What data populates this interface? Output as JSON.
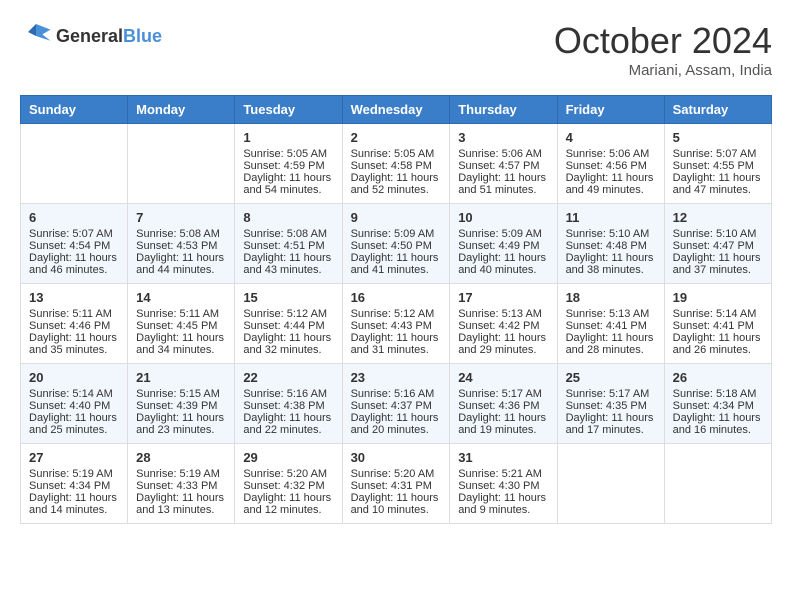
{
  "header": {
    "logo_general": "General",
    "logo_blue": "Blue",
    "month_title": "October 2024",
    "location": "Mariani, Assam, India"
  },
  "days_of_week": [
    "Sunday",
    "Monday",
    "Tuesday",
    "Wednesday",
    "Thursday",
    "Friday",
    "Saturday"
  ],
  "weeks": [
    [
      {
        "day": "",
        "sunrise": "",
        "sunset": "",
        "daylight": "",
        "empty": true
      },
      {
        "day": "",
        "sunrise": "",
        "sunset": "",
        "daylight": "",
        "empty": true
      },
      {
        "day": "1",
        "sunrise": "Sunrise: 5:05 AM",
        "sunset": "Sunset: 4:59 PM",
        "daylight": "Daylight: 11 hours and 54 minutes."
      },
      {
        "day": "2",
        "sunrise": "Sunrise: 5:05 AM",
        "sunset": "Sunset: 4:58 PM",
        "daylight": "Daylight: 11 hours and 52 minutes."
      },
      {
        "day": "3",
        "sunrise": "Sunrise: 5:06 AM",
        "sunset": "Sunset: 4:57 PM",
        "daylight": "Daylight: 11 hours and 51 minutes."
      },
      {
        "day": "4",
        "sunrise": "Sunrise: 5:06 AM",
        "sunset": "Sunset: 4:56 PM",
        "daylight": "Daylight: 11 hours and 49 minutes."
      },
      {
        "day": "5",
        "sunrise": "Sunrise: 5:07 AM",
        "sunset": "Sunset: 4:55 PM",
        "daylight": "Daylight: 11 hours and 47 minutes."
      }
    ],
    [
      {
        "day": "6",
        "sunrise": "Sunrise: 5:07 AM",
        "sunset": "Sunset: 4:54 PM",
        "daylight": "Daylight: 11 hours and 46 minutes."
      },
      {
        "day": "7",
        "sunrise": "Sunrise: 5:08 AM",
        "sunset": "Sunset: 4:53 PM",
        "daylight": "Daylight: 11 hours and 44 minutes."
      },
      {
        "day": "8",
        "sunrise": "Sunrise: 5:08 AM",
        "sunset": "Sunset: 4:51 PM",
        "daylight": "Daylight: 11 hours and 43 minutes."
      },
      {
        "day": "9",
        "sunrise": "Sunrise: 5:09 AM",
        "sunset": "Sunset: 4:50 PM",
        "daylight": "Daylight: 11 hours and 41 minutes."
      },
      {
        "day": "10",
        "sunrise": "Sunrise: 5:09 AM",
        "sunset": "Sunset: 4:49 PM",
        "daylight": "Daylight: 11 hours and 40 minutes."
      },
      {
        "day": "11",
        "sunrise": "Sunrise: 5:10 AM",
        "sunset": "Sunset: 4:48 PM",
        "daylight": "Daylight: 11 hours and 38 minutes."
      },
      {
        "day": "12",
        "sunrise": "Sunrise: 5:10 AM",
        "sunset": "Sunset: 4:47 PM",
        "daylight": "Daylight: 11 hours and 37 minutes."
      }
    ],
    [
      {
        "day": "13",
        "sunrise": "Sunrise: 5:11 AM",
        "sunset": "Sunset: 4:46 PM",
        "daylight": "Daylight: 11 hours and 35 minutes."
      },
      {
        "day": "14",
        "sunrise": "Sunrise: 5:11 AM",
        "sunset": "Sunset: 4:45 PM",
        "daylight": "Daylight: 11 hours and 34 minutes."
      },
      {
        "day": "15",
        "sunrise": "Sunrise: 5:12 AM",
        "sunset": "Sunset: 4:44 PM",
        "daylight": "Daylight: 11 hours and 32 minutes."
      },
      {
        "day": "16",
        "sunrise": "Sunrise: 5:12 AM",
        "sunset": "Sunset: 4:43 PM",
        "daylight": "Daylight: 11 hours and 31 minutes."
      },
      {
        "day": "17",
        "sunrise": "Sunrise: 5:13 AM",
        "sunset": "Sunset: 4:42 PM",
        "daylight": "Daylight: 11 hours and 29 minutes."
      },
      {
        "day": "18",
        "sunrise": "Sunrise: 5:13 AM",
        "sunset": "Sunset: 4:41 PM",
        "daylight": "Daylight: 11 hours and 28 minutes."
      },
      {
        "day": "19",
        "sunrise": "Sunrise: 5:14 AM",
        "sunset": "Sunset: 4:41 PM",
        "daylight": "Daylight: 11 hours and 26 minutes."
      }
    ],
    [
      {
        "day": "20",
        "sunrise": "Sunrise: 5:14 AM",
        "sunset": "Sunset: 4:40 PM",
        "daylight": "Daylight: 11 hours and 25 minutes."
      },
      {
        "day": "21",
        "sunrise": "Sunrise: 5:15 AM",
        "sunset": "Sunset: 4:39 PM",
        "daylight": "Daylight: 11 hours and 23 minutes."
      },
      {
        "day": "22",
        "sunrise": "Sunrise: 5:16 AM",
        "sunset": "Sunset: 4:38 PM",
        "daylight": "Daylight: 11 hours and 22 minutes."
      },
      {
        "day": "23",
        "sunrise": "Sunrise: 5:16 AM",
        "sunset": "Sunset: 4:37 PM",
        "daylight": "Daylight: 11 hours and 20 minutes."
      },
      {
        "day": "24",
        "sunrise": "Sunrise: 5:17 AM",
        "sunset": "Sunset: 4:36 PM",
        "daylight": "Daylight: 11 hours and 19 minutes."
      },
      {
        "day": "25",
        "sunrise": "Sunrise: 5:17 AM",
        "sunset": "Sunset: 4:35 PM",
        "daylight": "Daylight: 11 hours and 17 minutes."
      },
      {
        "day": "26",
        "sunrise": "Sunrise: 5:18 AM",
        "sunset": "Sunset: 4:34 PM",
        "daylight": "Daylight: 11 hours and 16 minutes."
      }
    ],
    [
      {
        "day": "27",
        "sunrise": "Sunrise: 5:19 AM",
        "sunset": "Sunset: 4:34 PM",
        "daylight": "Daylight: 11 hours and 14 minutes."
      },
      {
        "day": "28",
        "sunrise": "Sunrise: 5:19 AM",
        "sunset": "Sunset: 4:33 PM",
        "daylight": "Daylight: 11 hours and 13 minutes."
      },
      {
        "day": "29",
        "sunrise": "Sunrise: 5:20 AM",
        "sunset": "Sunset: 4:32 PM",
        "daylight": "Daylight: 11 hours and 12 minutes."
      },
      {
        "day": "30",
        "sunrise": "Sunrise: 5:20 AM",
        "sunset": "Sunset: 4:31 PM",
        "daylight": "Daylight: 11 hours and 10 minutes."
      },
      {
        "day": "31",
        "sunrise": "Sunrise: 5:21 AM",
        "sunset": "Sunset: 4:30 PM",
        "daylight": "Daylight: 11 hours and 9 minutes."
      },
      {
        "day": "",
        "sunrise": "",
        "sunset": "",
        "daylight": "",
        "empty": true
      },
      {
        "day": "",
        "sunrise": "",
        "sunset": "",
        "daylight": "",
        "empty": true
      }
    ]
  ]
}
